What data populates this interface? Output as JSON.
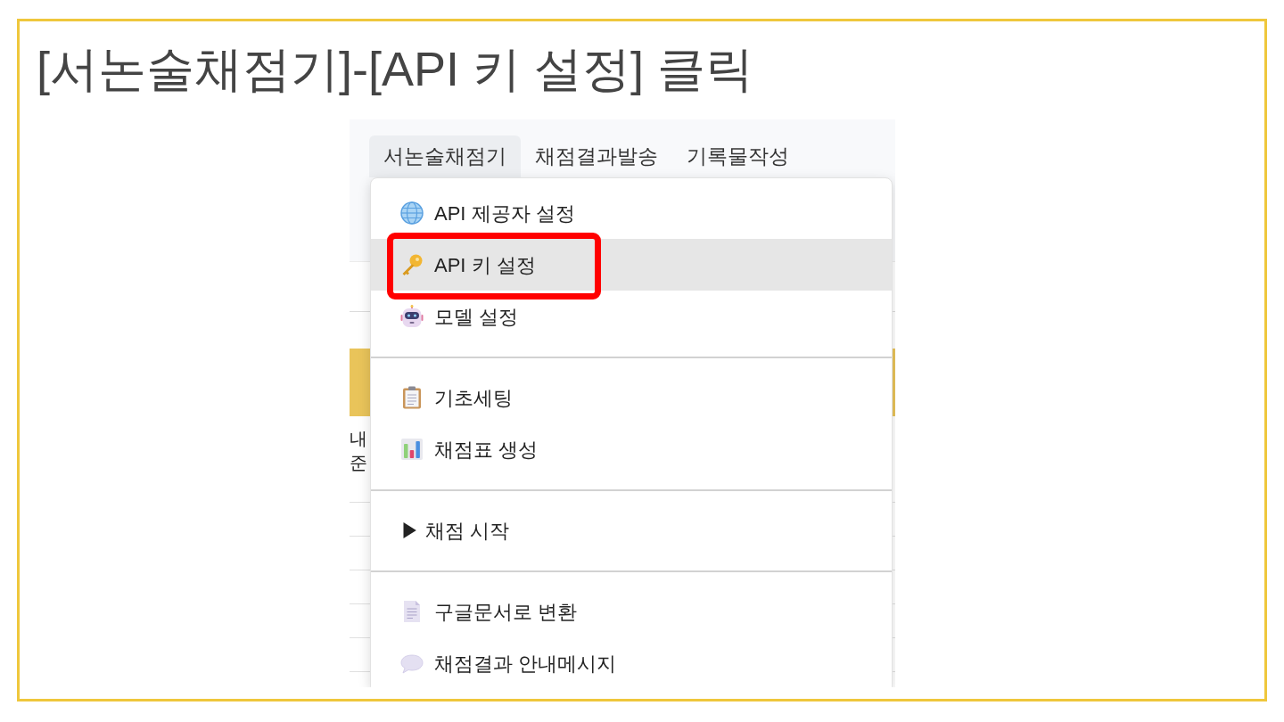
{
  "slide": {
    "title": "[서논술채점기]-[API 키 설정] 클릭"
  },
  "screenshot": {
    "menubar": {
      "tabs": [
        {
          "label": "서논술채점기",
          "selected": true
        },
        {
          "label": "채점결과발송",
          "selected": false
        },
        {
          "label": "기록물작성",
          "selected": false
        }
      ]
    },
    "table_fragment": {
      "cells": [
        "내",
        "준"
      ]
    },
    "dropdown": {
      "sections": [
        {
          "items": [
            {
              "kind": "globe",
              "label": "API 제공자 설정",
              "highlighted": false,
              "callout": false
            },
            {
              "kind": "key",
              "label": "API 키 설정",
              "highlighted": true,
              "callout": true
            },
            {
              "kind": "robot",
              "label": "모델 설정",
              "highlighted": false,
              "callout": false
            }
          ]
        },
        {
          "items": [
            {
              "kind": "clipboard",
              "label": "기초세팅",
              "highlighted": false,
              "callout": false
            },
            {
              "kind": "chart",
              "label": "채점표 생성",
              "highlighted": false,
              "callout": false
            }
          ]
        },
        {
          "items": [
            {
              "kind": "text",
              "label": "▶ 채점 시작",
              "highlighted": false,
              "callout": false
            }
          ]
        },
        {
          "items": [
            {
              "kind": "document",
              "label": "구글문서로 변환",
              "highlighted": false,
              "callout": false
            },
            {
              "kind": "speech",
              "label": "채점결과 안내메시지",
              "highlighted": false,
              "callout": false
            }
          ]
        }
      ]
    }
  }
}
